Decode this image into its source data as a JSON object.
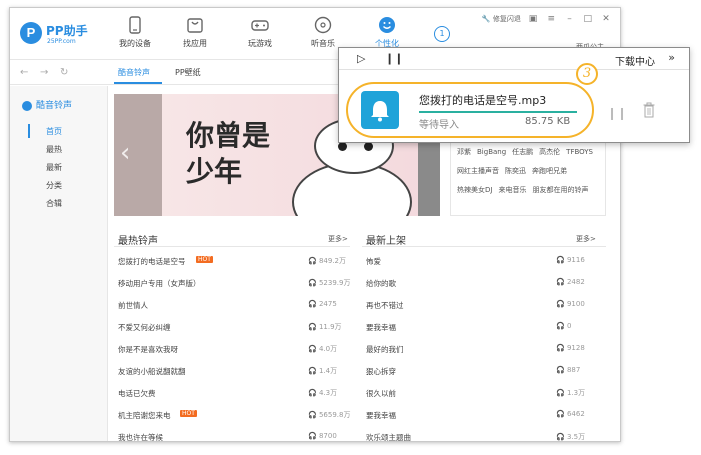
{
  "app": {
    "name": "PP助手",
    "domain": "25PP.com"
  },
  "nav": [
    {
      "label": "我的设备",
      "icon": "phone-icon"
    },
    {
      "label": "找应用",
      "icon": "bag-icon"
    },
    {
      "label": "玩游戏",
      "icon": "gamepad-icon"
    },
    {
      "label": "听音乐",
      "icon": "music-disc-icon"
    },
    {
      "label": "个性化",
      "icon": "smiley-icon"
    }
  ],
  "nav_badge": "1",
  "topright": {
    "repair": "修复闪退",
    "account": "西瓜公主"
  },
  "subtabs": [
    "酷音铃声",
    "PP壁纸"
  ],
  "sidebar": {
    "title": "酷音铃声",
    "items": [
      "首页",
      "最热",
      "最新",
      "分类",
      "合辑"
    ]
  },
  "banner": {
    "text": "你曾是少年"
  },
  "tags": {
    "rows": [
      [
        "邓紫",
        "BigBang",
        "任志鹏",
        "高杰伦",
        "TFBOYS"
      ],
      [
        "网红主播声音",
        "陈奕迅",
        "奔跑吧兄弟"
      ],
      [
        "热辣美女DJ",
        "来电音乐",
        "朋友都在用的铃声"
      ]
    ]
  },
  "lists": {
    "hot": {
      "title": "最热铃声",
      "more": "更多>",
      "rows": [
        {
          "name": "您拨打的电话是空号",
          "hot": "HOT",
          "count": "849.2万"
        },
        {
          "name": "移动用户专用（女声版）",
          "count": "5239.9万"
        },
        {
          "name": "前世情人",
          "count": "2475"
        },
        {
          "name": "不爱又何必纠缠",
          "count": "11.9万"
        },
        {
          "name": "你是不是喜欢我呀",
          "count": "4.0万"
        },
        {
          "name": "友谊的小船说翻就翻",
          "count": "1.4万"
        },
        {
          "name": "电话已欠费",
          "count": "4.3万"
        },
        {
          "name": "机主陪谢您来电",
          "hot": "HOT",
          "count": "5659.8万"
        },
        {
          "name": "我也许在等候",
          "count": "8700"
        }
      ]
    },
    "new": {
      "title": "最新上架",
      "more": "更多>",
      "rows": [
        {
          "name": "怖爱",
          "count": "9116"
        },
        {
          "name": "给你的歌",
          "count": "2482"
        },
        {
          "name": "再也不错过",
          "count": "9100"
        },
        {
          "name": "要我幸福",
          "count": "0"
        },
        {
          "name": "最好的我们",
          "count": "9128"
        },
        {
          "name": "狠心拆穿",
          "count": "887"
        },
        {
          "name": "很久以前",
          "count": "1.3万"
        },
        {
          "name": "要我幸福",
          "count": "6462"
        },
        {
          "name": "欢乐颂主题曲",
          "count": "3.5万"
        }
      ]
    }
  },
  "download_center": {
    "title": "下载中心",
    "collapse": "»",
    "item": {
      "name": "您拨打的电话是空号.mp3",
      "status": "等待导入",
      "size": "85.75 KB",
      "progress": 1.0
    }
  },
  "annotation": {
    "step": "3",
    "color": "#f5b32a"
  },
  "colors": {
    "accent": "#2a8de0",
    "hot": "#f36c21",
    "progress": "#2ab0a0"
  }
}
